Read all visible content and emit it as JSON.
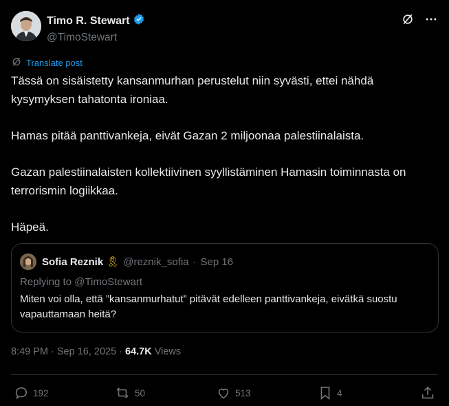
{
  "author": {
    "name": "Timo R. Stewart",
    "handle": "@TimoStewart",
    "verified": true
  },
  "translate_label": "Translate post",
  "body": [
    "Tässä on sisäistetty kansanmurhan perustelut niin syvästi, ettei nähdä kysymyksen tahatonta ironiaa.",
    "Hamas pitää panttivankeja, eivät Gazan 2 miljoonaa palestiinalaista.",
    "Gazan palestiinalaisten kollektiivinen syyllistäminen Hamasin toiminnasta on terrorismin logiikkaa.",
    "Häpeä."
  ],
  "quote": {
    "name": "Sofia Reznik",
    "emoji": "🎗",
    "handle": "@reznik_sofia",
    "sep": "·",
    "date": "Sep 16",
    "replying": "Replying to @TimoStewart",
    "text": "Miten voi olla, että ”kansanmurhatut” pitävät edelleen panttivankeja, eivätkä suostu vapauttamaan heitä?"
  },
  "meta": {
    "time": "8:49 PM · Sep 16, 2025 ·",
    "views_count": "64.7K",
    "views_label": "Views"
  },
  "stats": {
    "replies": "192",
    "reposts": "50",
    "likes": "513",
    "bookmarks": "4"
  },
  "colors": {
    "background": "#000000",
    "text": "#e7e9ea",
    "muted": "#71767b",
    "link": "#1d9bf0",
    "border": "#2f3336",
    "verified": "#1d9bf0"
  }
}
